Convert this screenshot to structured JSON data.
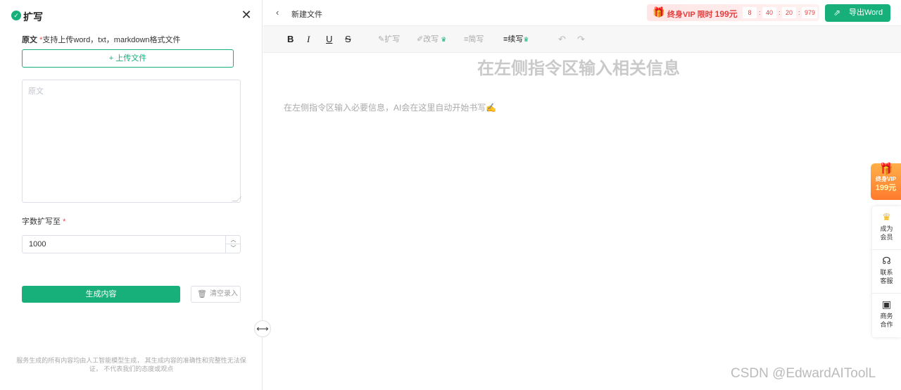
{
  "left_panel": {
    "logo_glyph": "✓",
    "title": "扩写",
    "close_glyph": "✕",
    "source_label": "原文",
    "source_required_mark": "*",
    "source_hint": "支持上传word，txt，markdown格式文件",
    "upload_button": "+ 上传文件",
    "source_placeholder": "原文",
    "word_count_label": "字数扩写至",
    "word_count_required_mark": "*",
    "word_count_value": "1000",
    "generate_button": "生成内容",
    "clear_button": "清空录入",
    "disclaimer": "服务生成的所有内容均由人工智能模型生成， 其生成内容的准确性和完整性无法保证， 不代表我们的态度或观点"
  },
  "header": {
    "doc_title": "新建文件",
    "vip_text": "终身VIP 限时",
    "vip_price": "199元",
    "countdown": [
      "8",
      "40",
      "20",
      "979"
    ],
    "countdown_sep": ":",
    "export_button": "导出Word"
  },
  "toolbar": {
    "bold": "B",
    "italic": "I",
    "underline": "U",
    "strike": "S",
    "expand": "扩写",
    "rewrite": "改写",
    "simplify": "简写",
    "continue": "续写",
    "undo_glyph": "↶",
    "redo_glyph": "↷"
  },
  "editor": {
    "title": "在左侧指令区输入相关信息",
    "placeholder": "在左侧指令区输入必要信息，AI会在这里自动开始书写✍️"
  },
  "float": {
    "vip_label": "终身VIP",
    "vip_price": "199元",
    "items": [
      {
        "label": "成为会员"
      },
      {
        "label": "联系客服"
      },
      {
        "label": "商务合作"
      }
    ]
  },
  "watermark": "CSDN @EdwardAIToolL"
}
